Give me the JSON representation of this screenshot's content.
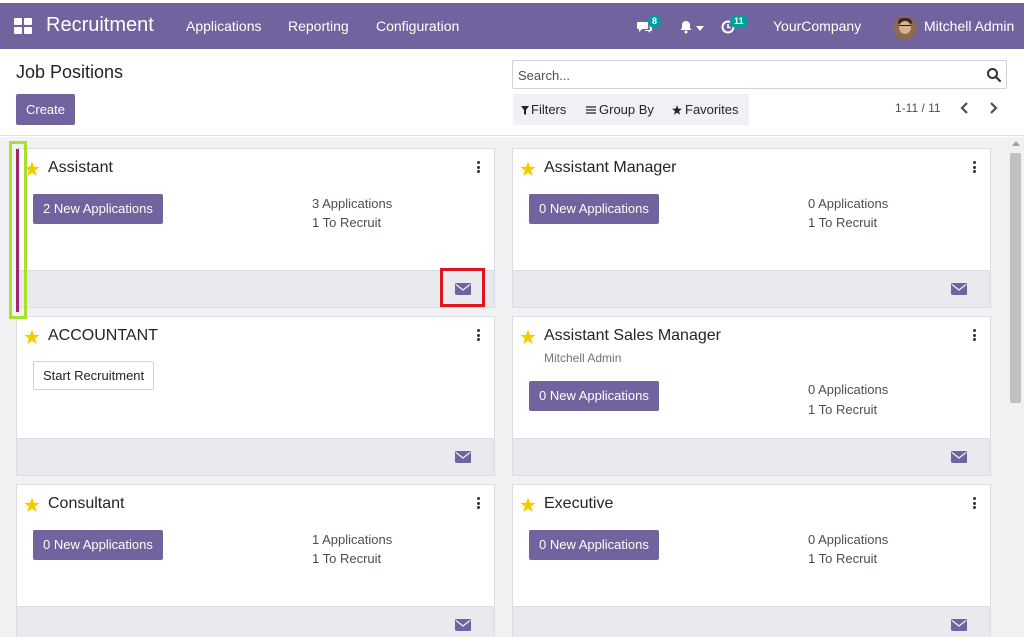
{
  "navbar": {
    "brand": "Recruitment",
    "menu": [
      "Applications",
      "Reporting",
      "Configuration"
    ],
    "messages_count": "8",
    "activities_count": "11",
    "company": "YourCompany",
    "user": "Mitchell Admin"
  },
  "control_panel": {
    "title": "Job Positions",
    "create_label": "Create",
    "search_placeholder": "Search...",
    "filters_label": "Filters",
    "groupby_label": "Group By",
    "favorites_label": "Favorites",
    "pager": "1-11 / 11"
  },
  "cards": [
    {
      "title": "Assistant",
      "subtitle": "",
      "new_apps": "2 New Applications",
      "applications": "3 Applications",
      "to_recruit": "1 To Recruit",
      "start_label": ""
    },
    {
      "title": "Assistant Manager",
      "subtitle": "",
      "new_apps": "0 New Applications",
      "applications": "0 Applications",
      "to_recruit": "1 To Recruit",
      "start_label": ""
    },
    {
      "title": "ACCOUNTANT",
      "subtitle": "",
      "new_apps": "",
      "applications": "",
      "to_recruit": "",
      "start_label": "Start Recruitment"
    },
    {
      "title": "Assistant Sales Manager",
      "subtitle": "Mitchell Admin",
      "new_apps": "0 New Applications",
      "applications": "0 Applications",
      "to_recruit": "1 To Recruit",
      "start_label": ""
    },
    {
      "title": "Consultant",
      "subtitle": "",
      "new_apps": "0 New Applications",
      "applications": "1 Applications",
      "to_recruit": "1 To Recruit",
      "start_label": ""
    },
    {
      "title": "Executive",
      "subtitle": "",
      "new_apps": "0 New Applications",
      "applications": "0 Applications",
      "to_recruit": "1 To Recruit",
      "start_label": ""
    }
  ],
  "colors": {
    "primary": "#71639e",
    "star": "#f3cc00",
    "highlight_red": "#e0141e",
    "highlight_green": "#a8e02a",
    "color_tag": "#a0256b",
    "badge": "#00a09d"
  }
}
